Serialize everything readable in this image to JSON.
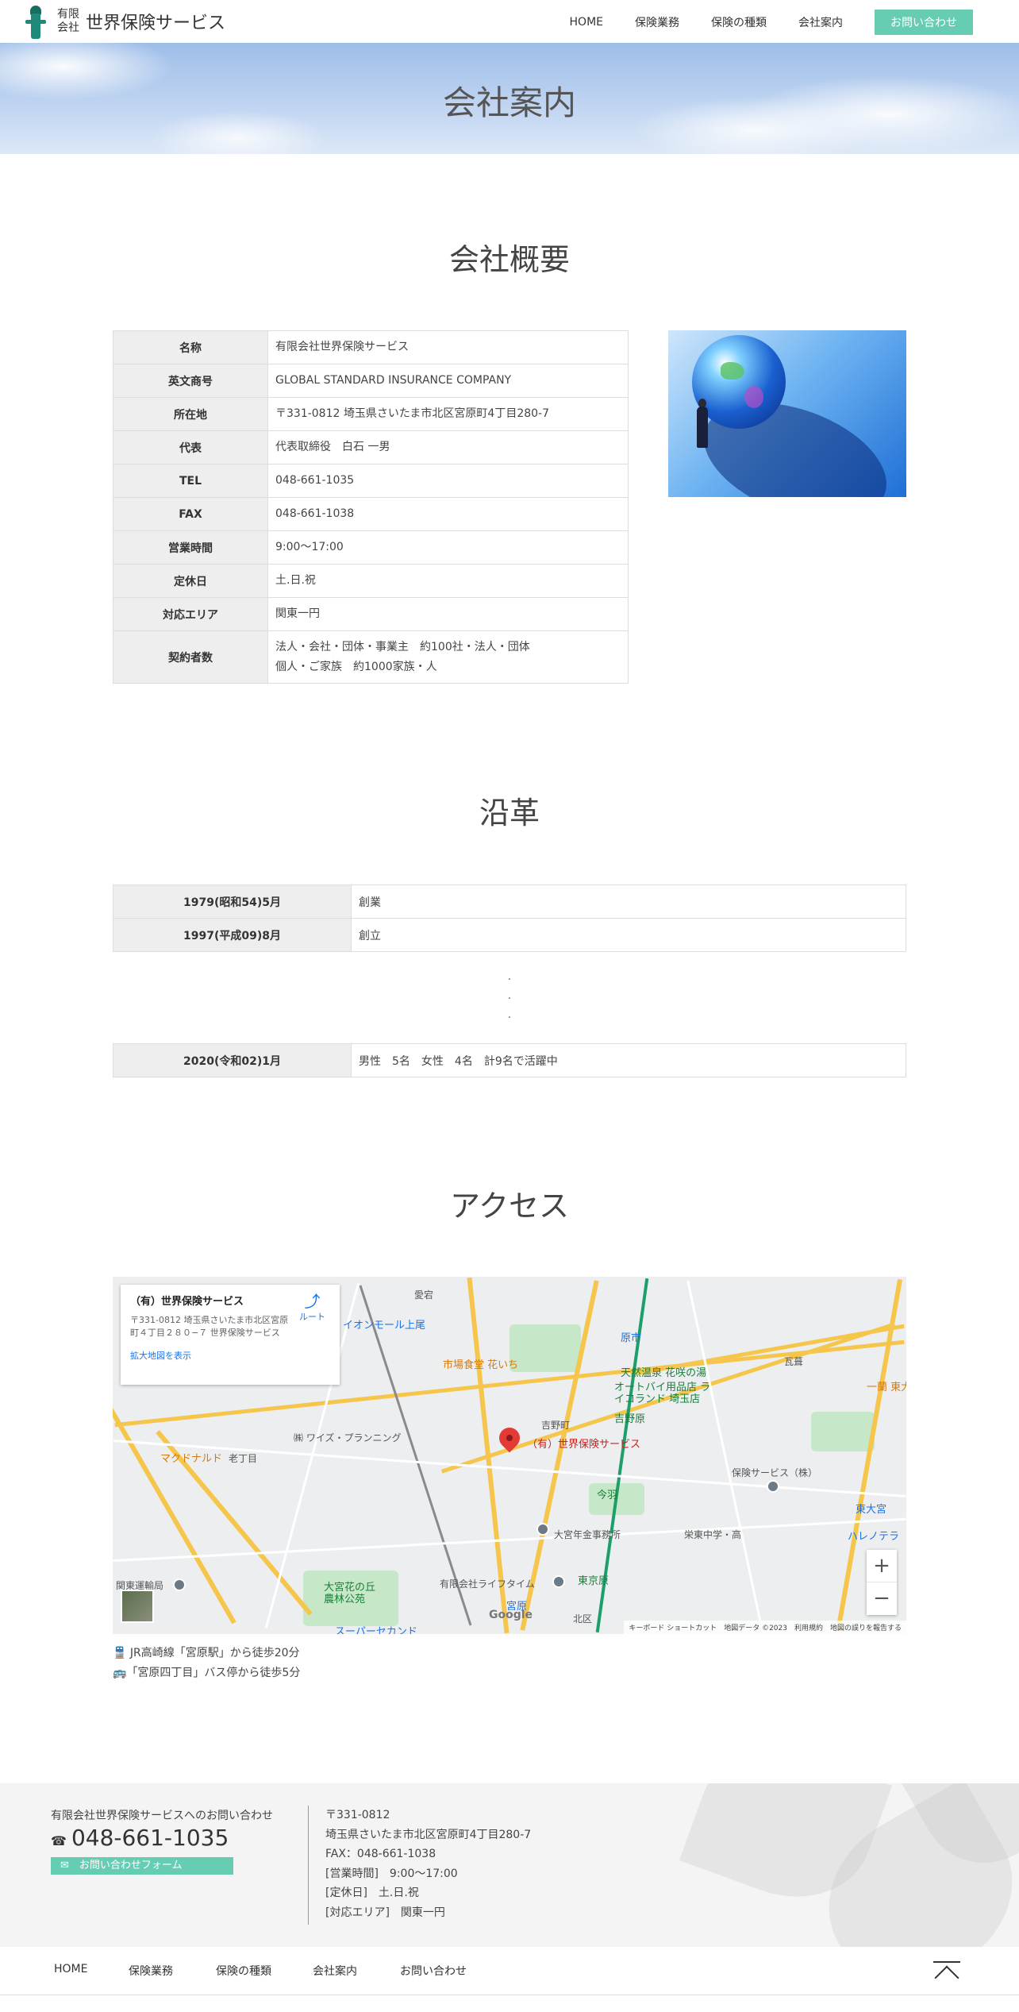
{
  "header": {
    "logo_sub": [
      "有限",
      "会社"
    ],
    "logo_name": "世界保険サービス",
    "nav": [
      "HOME",
      "保険業務",
      "保険の種類",
      "会社案内"
    ],
    "contact": "お問い合わせ"
  },
  "hero": {
    "title": "会社案内"
  },
  "overview": {
    "title": "会社概要",
    "rows": [
      {
        "label": "名称",
        "value": "有限会社世界保険サービス"
      },
      {
        "label": "英文商号",
        "value": "GLOBAL STANDARD INSURANCE COMPANY"
      },
      {
        "label": "所在地",
        "value": "〒331-0812 埼玉県さいたま市北区宮原町4丁目280-7"
      },
      {
        "label": "代表",
        "value": "代表取締役　白石 一男"
      },
      {
        "label": "TEL",
        "value": "048-661-1035"
      },
      {
        "label": "FAX",
        "value": "048-661-1038"
      },
      {
        "label": "営業時間",
        "value": "9:00～17:00"
      },
      {
        "label": "定休日",
        "value": "土.日.祝"
      },
      {
        "label": "対応エリア",
        "value": "関東一円"
      }
    ],
    "contracts": {
      "label": "契約者数",
      "line1": "法人・会社・団体・事業主　約100社・法人・団体",
      "line2": "個人・ご家族　約1000家族・人"
    }
  },
  "history": {
    "title": "沿革",
    "rows": [
      {
        "date": "1979(昭和54)5月",
        "event": "創業"
      },
      {
        "date": "1997(平成09)8月",
        "event": "創立"
      }
    ],
    "ellipsis": [
      ".",
      ".",
      "."
    ],
    "last": {
      "date": "2020(令和02)1月",
      "event": "男性　5名　女性　4名　計9名で活躍中"
    }
  },
  "access": {
    "title": "アクセス",
    "map": {
      "card_title": "（有）世界保険サービス",
      "card_address": "〒331-0812 埼玉県さいたま市北区宮原町４丁目２８０−７ 世界保険サービス",
      "card_link": "拡大地図を表示",
      "route": "ルート",
      "zoom_in": "+",
      "zoom_out": "−",
      "google": "Google",
      "attribution": "キーボード ショートカット　地図データ ©2023　利用規約　地図の誤りを報告する",
      "labels": {
        "onmall": "イオンモール上尾",
        "ichiba": "市場食堂 花いち",
        "tennen": "天然温泉 花咲の湯",
        "autobike": "オートバイ用品店 ライコランド 埼玉店",
        "yoshinohara": "吉野原",
        "yoshinocho": "吉野町",
        "haraichi": "原市",
        "mcd": "マクドナルド",
        "oihon": "老丁目",
        "wise": "㈱ ワイズ・プランニング",
        "pin": "（有）世界保険サービス",
        "hoken": "保険サービス（株）",
        "imaha": "今羽",
        "nenkin": "大宮年金事務所",
        "sakae": "栄東中学・高",
        "higashiomiya": "東大宮",
        "hareno": "ハレノテラ",
        "lifetime": "有限会社ライフタイム",
        "higashihara": "東京原",
        "omiyahana": "大宮花の丘 農林公苑",
        "kanto": "関東運輸局",
        "secondst": "スーパーセカンド",
        "kitaku": "北区",
        "miyahara": "宮原",
        "ranenh": "一蘭 東大",
        "gamo": "瓦葺",
        "atago": "愛宕"
      }
    },
    "notes": [
      "JR高崎線「宮原駅」から徒歩20分",
      "「宮原四丁目」バス停から徒歩5分"
    ]
  },
  "footer": {
    "caption": "有限会社世界保険サービスへのお問い合わせ",
    "tel": "048-661-1035",
    "form": "お問い合わせフォーム",
    "address_lines": [
      "〒331-0812",
      "埼玉県さいたま市北区宮原町4丁目280-7",
      "FAX：048-661-1038",
      "[営業時間]　9:00～17:00",
      "[定休日]　土.日.祝",
      "[対応エリア]　関東一円"
    ]
  },
  "bottom_nav": [
    "HOME",
    "保険業務",
    "保険の種類",
    "会社案内",
    "お問い合わせ"
  ],
  "colors": {
    "accent": "#66cdb3",
    "th_bg": "#eeeeee",
    "footer_bg": "#f4f4f4"
  }
}
